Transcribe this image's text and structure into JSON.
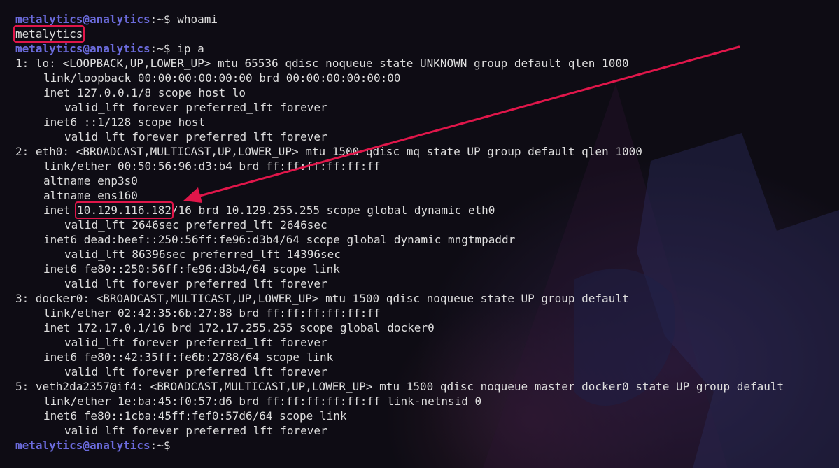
{
  "prompt": {
    "user_host": "metalytics@analytics",
    "path": ":~$"
  },
  "colors": {
    "prompt": "#6b6bdc",
    "text": "#dddddd",
    "highlight": "#e0164a",
    "background": "#0e0c14"
  },
  "commands": {
    "whoami": "whoami",
    "ip_a": "ip a"
  },
  "whoami_output": "metalytics",
  "ip": {
    "lo": {
      "header": "1: lo: <LOOPBACK,UP,LOWER_UP> mtu 65536 qdisc noqueue state UNKNOWN group default qlen 1000",
      "link": "link/loopback 00:00:00:00:00:00 brd 00:00:00:00:00:00",
      "inet": "inet 127.0.0.1/8 scope host lo",
      "inet_lft": "valid_lft forever preferred_lft forever",
      "inet6": "inet6 ::1/128 scope host",
      "inet6_lft": "valid_lft forever preferred_lft forever"
    },
    "eth0": {
      "header": "2: eth0: <BROADCAST,MULTICAST,UP,LOWER_UP> mtu 1500 qdisc mq state UP group default qlen 1000",
      "link": "link/ether 00:50:56:96:d3:b4 brd ff:ff:ff:ff:ff:ff",
      "altname1": "altname enp3s0",
      "altname2": "altname ens160",
      "inet_prefix": "inet ",
      "inet_ip": "10.129.116.182",
      "inet_rest": "/16 brd 10.129.255.255 scope global dynamic eth0",
      "inet_lft": "valid_lft 2646sec preferred_lft 2646sec",
      "inet6_global": "inet6 dead:beef::250:56ff:fe96:d3b4/64 scope global dynamic mngtmpaddr",
      "inet6_global_lft": "valid_lft 86396sec preferred_lft 14396sec",
      "inet6_link": "inet6 fe80::250:56ff:fe96:d3b4/64 scope link",
      "inet6_link_lft": "valid_lft forever preferred_lft forever"
    },
    "docker0": {
      "header": "3: docker0: <BROADCAST,MULTICAST,UP,LOWER_UP> mtu 1500 qdisc noqueue state UP group default",
      "link": "link/ether 02:42:35:6b:27:88 brd ff:ff:ff:ff:ff:ff",
      "inet": "inet 172.17.0.1/16 brd 172.17.255.255 scope global docker0",
      "inet_lft": "valid_lft forever preferred_lft forever",
      "inet6": "inet6 fe80::42:35ff:fe6b:2788/64 scope link",
      "inet6_lft": "valid_lft forever preferred_lft forever"
    },
    "veth": {
      "header": "5: veth2da2357@if4: <BROADCAST,MULTICAST,UP,LOWER_UP> mtu 1500 qdisc noqueue master docker0 state UP group default",
      "link": "link/ether 1e:ba:45:f0:57:d6 brd ff:ff:ff:ff:ff:ff link-netnsid 0",
      "inet6": "inet6 fe80::1cba:45ff:fef0:57d6/64 scope link",
      "inet6_lft": "valid_lft forever preferred_lft forever"
    }
  }
}
